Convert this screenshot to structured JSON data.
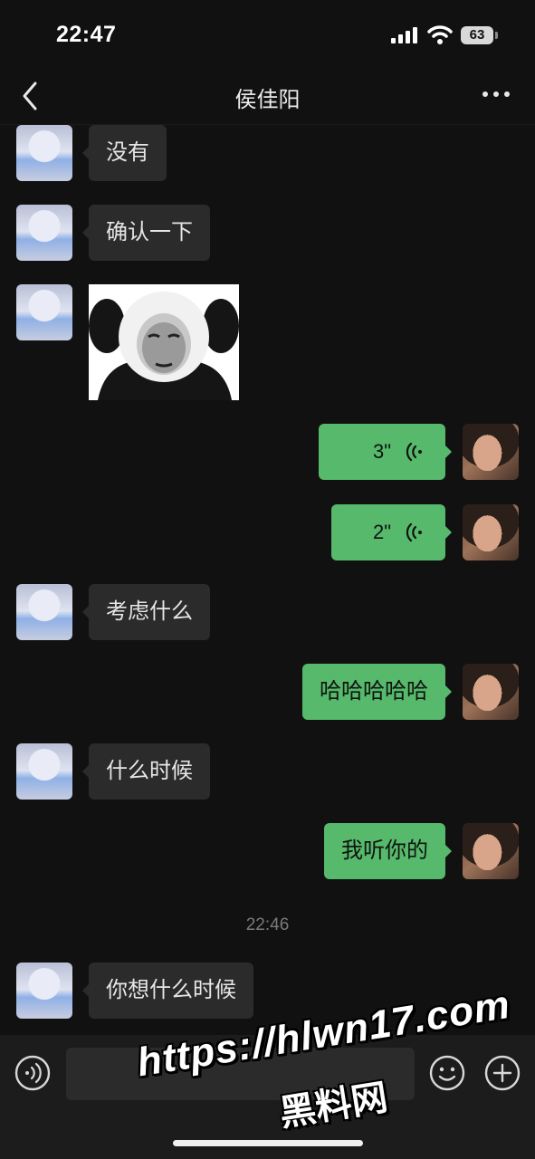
{
  "status_bar": {
    "time": "22:47",
    "battery": "63"
  },
  "nav": {
    "title": "侯佳阳",
    "back_icon": "chevron-left-icon",
    "more_icon": "ellipsis-icon"
  },
  "messages": [
    {
      "side": "in",
      "type": "text",
      "text": "没有"
    },
    {
      "side": "in",
      "type": "text",
      "text": "确认一下"
    },
    {
      "side": "in",
      "type": "sticker",
      "text": ""
    },
    {
      "side": "out",
      "type": "voice",
      "text": "3\""
    },
    {
      "side": "out",
      "type": "voice",
      "text": "2\""
    },
    {
      "side": "in",
      "type": "text",
      "text": "考虑什么"
    },
    {
      "side": "out",
      "type": "text",
      "text": "哈哈哈哈哈"
    },
    {
      "side": "in",
      "type": "text",
      "text": "什么时候"
    },
    {
      "side": "out",
      "type": "text",
      "text": "我听你的"
    },
    {
      "side": "in",
      "type": "text",
      "text": "你想什么时候"
    }
  ],
  "timestamp": "22:46",
  "input_bar": {
    "voice_icon": "voice-icon",
    "emoji_icon": "smiley-icon",
    "plus_icon": "plus-circle-icon",
    "placeholder": ""
  },
  "watermark": {
    "url": "https://hlwn17.com",
    "name": "黑料网"
  },
  "colors": {
    "background": "#111111",
    "incoming_bubble": "#2b2b2b",
    "outgoing_bubble": "#56b96b"
  }
}
